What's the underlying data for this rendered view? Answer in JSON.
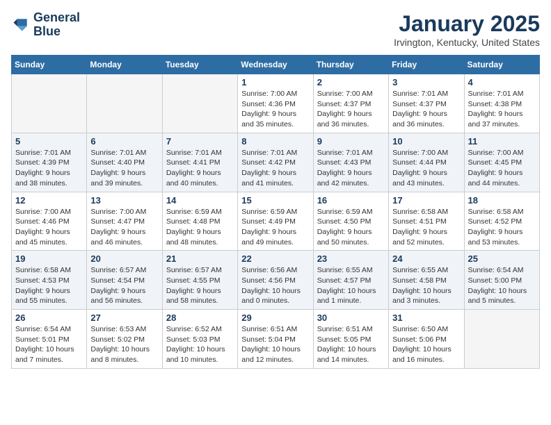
{
  "header": {
    "logo_line1": "General",
    "logo_line2": "Blue",
    "title": "January 2025",
    "subtitle": "Irvington, Kentucky, United States"
  },
  "days_of_week": [
    "Sunday",
    "Monday",
    "Tuesday",
    "Wednesday",
    "Thursday",
    "Friday",
    "Saturday"
  ],
  "weeks": [
    {
      "shaded": false,
      "days": [
        {
          "num": "",
          "info": ""
        },
        {
          "num": "",
          "info": ""
        },
        {
          "num": "",
          "info": ""
        },
        {
          "num": "1",
          "info": "Sunrise: 7:00 AM\nSunset: 4:36 PM\nDaylight: 9 hours and 35 minutes."
        },
        {
          "num": "2",
          "info": "Sunrise: 7:00 AM\nSunset: 4:37 PM\nDaylight: 9 hours and 36 minutes."
        },
        {
          "num": "3",
          "info": "Sunrise: 7:01 AM\nSunset: 4:37 PM\nDaylight: 9 hours and 36 minutes."
        },
        {
          "num": "4",
          "info": "Sunrise: 7:01 AM\nSunset: 4:38 PM\nDaylight: 9 hours and 37 minutes."
        }
      ]
    },
    {
      "shaded": true,
      "days": [
        {
          "num": "5",
          "info": "Sunrise: 7:01 AM\nSunset: 4:39 PM\nDaylight: 9 hours and 38 minutes."
        },
        {
          "num": "6",
          "info": "Sunrise: 7:01 AM\nSunset: 4:40 PM\nDaylight: 9 hours and 39 minutes."
        },
        {
          "num": "7",
          "info": "Sunrise: 7:01 AM\nSunset: 4:41 PM\nDaylight: 9 hours and 40 minutes."
        },
        {
          "num": "8",
          "info": "Sunrise: 7:01 AM\nSunset: 4:42 PM\nDaylight: 9 hours and 41 minutes."
        },
        {
          "num": "9",
          "info": "Sunrise: 7:01 AM\nSunset: 4:43 PM\nDaylight: 9 hours and 42 minutes."
        },
        {
          "num": "10",
          "info": "Sunrise: 7:00 AM\nSunset: 4:44 PM\nDaylight: 9 hours and 43 minutes."
        },
        {
          "num": "11",
          "info": "Sunrise: 7:00 AM\nSunset: 4:45 PM\nDaylight: 9 hours and 44 minutes."
        }
      ]
    },
    {
      "shaded": false,
      "days": [
        {
          "num": "12",
          "info": "Sunrise: 7:00 AM\nSunset: 4:46 PM\nDaylight: 9 hours and 45 minutes."
        },
        {
          "num": "13",
          "info": "Sunrise: 7:00 AM\nSunset: 4:47 PM\nDaylight: 9 hours and 46 minutes."
        },
        {
          "num": "14",
          "info": "Sunrise: 6:59 AM\nSunset: 4:48 PM\nDaylight: 9 hours and 48 minutes."
        },
        {
          "num": "15",
          "info": "Sunrise: 6:59 AM\nSunset: 4:49 PM\nDaylight: 9 hours and 49 minutes."
        },
        {
          "num": "16",
          "info": "Sunrise: 6:59 AM\nSunset: 4:50 PM\nDaylight: 9 hours and 50 minutes."
        },
        {
          "num": "17",
          "info": "Sunrise: 6:58 AM\nSunset: 4:51 PM\nDaylight: 9 hours and 52 minutes."
        },
        {
          "num": "18",
          "info": "Sunrise: 6:58 AM\nSunset: 4:52 PM\nDaylight: 9 hours and 53 minutes."
        }
      ]
    },
    {
      "shaded": true,
      "days": [
        {
          "num": "19",
          "info": "Sunrise: 6:58 AM\nSunset: 4:53 PM\nDaylight: 9 hours and 55 minutes."
        },
        {
          "num": "20",
          "info": "Sunrise: 6:57 AM\nSunset: 4:54 PM\nDaylight: 9 hours and 56 minutes."
        },
        {
          "num": "21",
          "info": "Sunrise: 6:57 AM\nSunset: 4:55 PM\nDaylight: 9 hours and 58 minutes."
        },
        {
          "num": "22",
          "info": "Sunrise: 6:56 AM\nSunset: 4:56 PM\nDaylight: 10 hours and 0 minutes."
        },
        {
          "num": "23",
          "info": "Sunrise: 6:55 AM\nSunset: 4:57 PM\nDaylight: 10 hours and 1 minute."
        },
        {
          "num": "24",
          "info": "Sunrise: 6:55 AM\nSunset: 4:58 PM\nDaylight: 10 hours and 3 minutes."
        },
        {
          "num": "25",
          "info": "Sunrise: 6:54 AM\nSunset: 5:00 PM\nDaylight: 10 hours and 5 minutes."
        }
      ]
    },
    {
      "shaded": false,
      "days": [
        {
          "num": "26",
          "info": "Sunrise: 6:54 AM\nSunset: 5:01 PM\nDaylight: 10 hours and 7 minutes."
        },
        {
          "num": "27",
          "info": "Sunrise: 6:53 AM\nSunset: 5:02 PM\nDaylight: 10 hours and 8 minutes."
        },
        {
          "num": "28",
          "info": "Sunrise: 6:52 AM\nSunset: 5:03 PM\nDaylight: 10 hours and 10 minutes."
        },
        {
          "num": "29",
          "info": "Sunrise: 6:51 AM\nSunset: 5:04 PM\nDaylight: 10 hours and 12 minutes."
        },
        {
          "num": "30",
          "info": "Sunrise: 6:51 AM\nSunset: 5:05 PM\nDaylight: 10 hours and 14 minutes."
        },
        {
          "num": "31",
          "info": "Sunrise: 6:50 AM\nSunset: 5:06 PM\nDaylight: 10 hours and 16 minutes."
        },
        {
          "num": "",
          "info": ""
        }
      ]
    }
  ]
}
